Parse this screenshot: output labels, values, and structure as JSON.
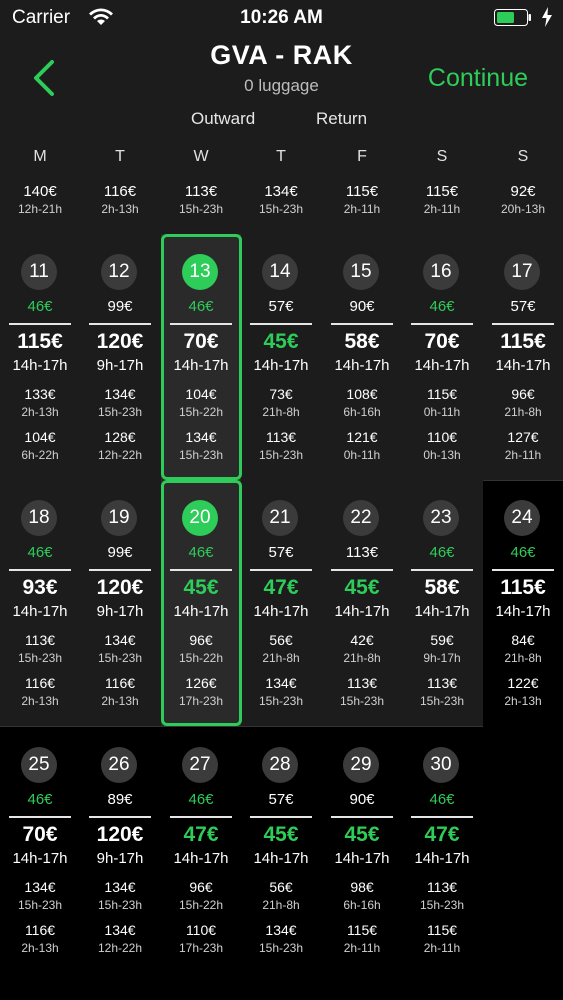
{
  "status": {
    "carrier": "Carrier",
    "time": "10:26 AM",
    "accent": "#2ecc59"
  },
  "nav": {
    "route": "GVA - RAK",
    "luggage": "0 luggage",
    "continue": "Continue"
  },
  "tabs": {
    "outward": "Outward",
    "return": "Return"
  },
  "weekdays": [
    "M",
    "T",
    "W",
    "T",
    "F",
    "S",
    "S"
  ],
  "partial_week": [
    {
      "price": "140€",
      "time": "12h-21h"
    },
    {
      "price": "116€",
      "time": "2h-13h"
    },
    {
      "price": "113€",
      "time": "15h-23h"
    },
    {
      "price": "134€",
      "time": "15h-23h"
    },
    {
      "price": "115€",
      "time": "2h-11h"
    },
    {
      "price": "115€",
      "time": "2h-11h"
    },
    {
      "price": "92€",
      "time": "20h-13h"
    }
  ],
  "weeks": [
    [
      {
        "day": "11",
        "top": "46€",
        "top_green": true,
        "price": "115€",
        "price_green": false,
        "time": "14h-17h",
        "o1p": "133€",
        "o1t": "2h-13h",
        "o2p": "104€",
        "o2t": "6h-22h",
        "selected": false
      },
      {
        "day": "12",
        "top": "99€",
        "top_green": false,
        "price": "120€",
        "price_green": false,
        "time": "9h-17h",
        "o1p": "134€",
        "o1t": "15h-23h",
        "o2p": "128€",
        "o2t": "12h-22h",
        "selected": false
      },
      {
        "day": "13",
        "top": "46€",
        "top_green": true,
        "price": "70€",
        "price_green": false,
        "time": "14h-17h",
        "o1p": "104€",
        "o1t": "15h-22h",
        "o2p": "134€",
        "o2t": "15h-23h",
        "selected": true
      },
      {
        "day": "14",
        "top": "57€",
        "top_green": false,
        "price": "45€",
        "price_green": true,
        "time": "14h-17h",
        "o1p": "73€",
        "o1t": "21h-8h",
        "o2p": "113€",
        "o2t": "15h-23h",
        "selected": false
      },
      {
        "day": "15",
        "top": "90€",
        "top_green": false,
        "price": "58€",
        "price_green": false,
        "time": "14h-17h",
        "o1p": "108€",
        "o1t": "6h-16h",
        "o2p": "121€",
        "o2t": "0h-11h",
        "selected": false
      },
      {
        "day": "16",
        "top": "46€",
        "top_green": true,
        "price": "70€",
        "price_green": false,
        "time": "14h-17h",
        "o1p": "115€",
        "o1t": "0h-11h",
        "o2p": "110€",
        "o2t": "0h-13h",
        "selected": false
      },
      {
        "day": "17",
        "top": "57€",
        "top_green": false,
        "price": "115€",
        "price_green": false,
        "time": "14h-17h",
        "o1p": "96€",
        "o1t": "21h-8h",
        "o2p": "127€",
        "o2t": "2h-11h",
        "selected": false
      }
    ],
    [
      {
        "day": "18",
        "top": "46€",
        "top_green": true,
        "price": "93€",
        "price_green": false,
        "time": "14h-17h",
        "o1p": "113€",
        "o1t": "15h-23h",
        "o2p": "116€",
        "o2t": "2h-13h",
        "selected": false
      },
      {
        "day": "19",
        "top": "99€",
        "top_green": false,
        "price": "120€",
        "price_green": false,
        "time": "9h-17h",
        "o1p": "134€",
        "o1t": "15h-23h",
        "o2p": "116€",
        "o2t": "2h-13h",
        "selected": false
      },
      {
        "day": "20",
        "top": "46€",
        "top_green": true,
        "price": "45€",
        "price_green": true,
        "time": "14h-17h",
        "o1p": "96€",
        "o1t": "15h-22h",
        "o2p": "126€",
        "o2t": "17h-23h",
        "selected": true
      },
      {
        "day": "21",
        "top": "57€",
        "top_green": false,
        "price": "47€",
        "price_green": true,
        "time": "14h-17h",
        "o1p": "56€",
        "o1t": "21h-8h",
        "o2p": "134€",
        "o2t": "15h-23h",
        "selected": false
      },
      {
        "day": "22",
        "top": "113€",
        "top_green": false,
        "price": "45€",
        "price_green": true,
        "time": "14h-17h",
        "o1p": "42€",
        "o1t": "21h-8h",
        "o2p": "113€",
        "o2t": "15h-23h",
        "selected": false
      },
      {
        "day": "23",
        "top": "46€",
        "top_green": true,
        "price": "58€",
        "price_green": false,
        "time": "14h-17h",
        "o1p": "59€",
        "o1t": "9h-17h",
        "o2p": "113€",
        "o2t": "15h-23h",
        "selected": false
      },
      {
        "day": "24",
        "top": "46€",
        "top_green": true,
        "price": "115€",
        "price_green": false,
        "time": "14h-17h",
        "o1p": "84€",
        "o1t": "21h-8h",
        "o2p": "122€",
        "o2t": "2h-13h",
        "selected": false
      }
    ],
    [
      {
        "day": "25",
        "top": "46€",
        "top_green": true,
        "price": "70€",
        "price_green": false,
        "time": "14h-17h",
        "o1p": "134€",
        "o1t": "15h-23h",
        "o2p": "116€",
        "o2t": "2h-13h",
        "selected": false
      },
      {
        "day": "26",
        "top": "89€",
        "top_green": false,
        "price": "120€",
        "price_green": false,
        "time": "9h-17h",
        "o1p": "134€",
        "o1t": "15h-23h",
        "o2p": "134€",
        "o2t": "12h-22h",
        "selected": false
      },
      {
        "day": "27",
        "top": "46€",
        "top_green": true,
        "price": "47€",
        "price_green": true,
        "time": "14h-17h",
        "o1p": "96€",
        "o1t": "15h-22h",
        "o2p": "110€",
        "o2t": "17h-23h",
        "selected": false
      },
      {
        "day": "28",
        "top": "57€",
        "top_green": false,
        "price": "45€",
        "price_green": true,
        "time": "14h-17h",
        "o1p": "56€",
        "o1t": "21h-8h",
        "o2p": "134€",
        "o2t": "15h-23h",
        "selected": false
      },
      {
        "day": "29",
        "top": "90€",
        "top_green": false,
        "price": "45€",
        "price_green": true,
        "time": "14h-17h",
        "o1p": "98€",
        "o1t": "6h-16h",
        "o2p": "115€",
        "o2t": "2h-11h",
        "selected": false
      },
      {
        "day": "30",
        "top": "46€",
        "top_green": true,
        "price": "47€",
        "price_green": true,
        "time": "14h-17h",
        "o1p": "113€",
        "o1t": "15h-23h",
        "o2p": "115€",
        "o2t": "2h-11h",
        "selected": false
      }
    ]
  ]
}
